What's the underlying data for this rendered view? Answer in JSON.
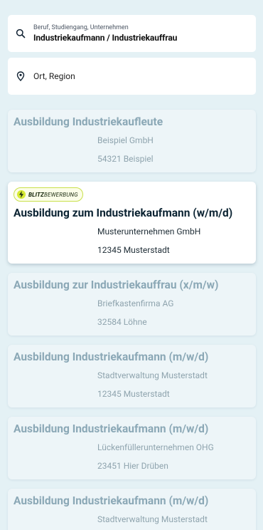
{
  "search": {
    "label": "Beruf, Studiengang, Unternehmen",
    "value": "Industriekaufmann / Industriekauffrau",
    "icon": "search-icon"
  },
  "location": {
    "placeholder": "Ort, Region",
    "icon": "location-pin-icon"
  },
  "badge": {
    "part1": "BLITZ",
    "part2": "BEWERBUNG",
    "icon": "lightning-icon"
  },
  "results": [
    {
      "title": "Ausbildung Industriekaufleute",
      "company": "Beispiel GmbH",
      "city": "54321 Beispiel"
    },
    {
      "title": "Ausbildung zum Industriekaufmann (w/m/d)",
      "company": "Musterunternehmen GmbH",
      "city": "12345 Musterstadt"
    },
    {
      "title": "Ausbildung zur Industriekauffrau (x/m/w)",
      "company": "Briefkastenfirma AG",
      "city": "32584 Löhne"
    },
    {
      "title": "Ausbildung Industriekaufmann (m/w/d)",
      "company": "Stadtverwaltung Musterstadt",
      "city": "12345 Musterstadt"
    },
    {
      "title": "Ausbildung Industriekaufmann (m/w/d)",
      "company": "Lückenfüllerunternehmen OHG",
      "city": "23451 Hier Drüben"
    },
    {
      "title": "Ausbildung Industriekaufmann (m/w/d)",
      "company": "Stadtverwaltung Musterstadt",
      "city": ""
    }
  ],
  "colors": {
    "background": "#e4f1f5",
    "badge_accent": "#d6ea34",
    "active_title": "#0c2433",
    "faded_title": "#8ba8b6"
  }
}
